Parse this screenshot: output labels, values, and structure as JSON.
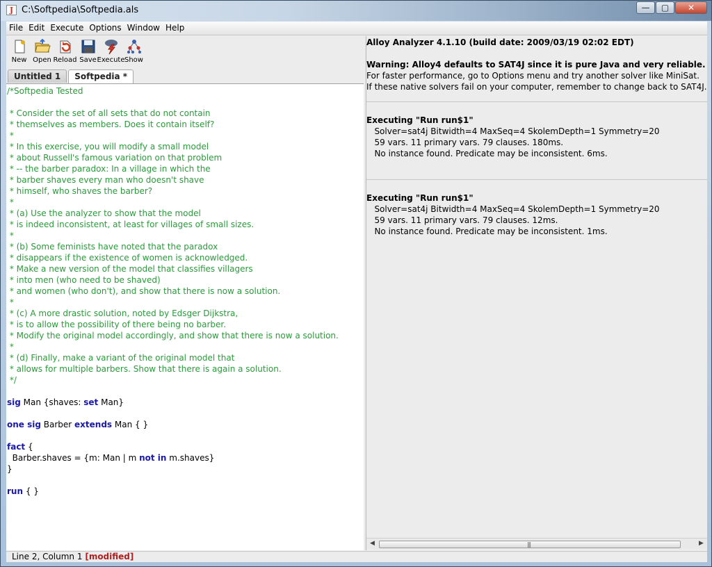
{
  "window": {
    "title": "C:\\Softpedia\\Softpedia.als",
    "minimize": "—",
    "maximize": "▢",
    "close": "✕"
  },
  "menubar": [
    "File",
    "Edit",
    "Execute",
    "Options",
    "Window",
    "Help"
  ],
  "toolbar": [
    {
      "label": "New",
      "icon": "new-icon"
    },
    {
      "label": "Open",
      "icon": "open-icon"
    },
    {
      "label": "Reload",
      "icon": "reload-icon"
    },
    {
      "label": "Save",
      "icon": "save-icon"
    },
    {
      "label": "Execute",
      "icon": "execute-icon"
    },
    {
      "label": "Show",
      "icon": "show-icon"
    }
  ],
  "tabs": [
    {
      "label": "Untitled 1",
      "active": false
    },
    {
      "label": "Softpedia *",
      "active": true
    }
  ],
  "editor": {
    "lines": [
      [
        {
          "t": "/*Softpedia Tested",
          "c": "cmt"
        }
      ],
      [],
      [
        {
          "t": " * Consider the set of all sets that do not contain",
          "c": "cmt"
        }
      ],
      [
        {
          "t": " * themselves as members. Does it contain itself?",
          "c": "cmt"
        }
      ],
      [
        {
          "t": " *",
          "c": "cmt"
        }
      ],
      [
        {
          "t": " * In this exercise, you will modify a small model",
          "c": "cmt"
        }
      ],
      [
        {
          "t": " * about Russell's famous variation on that problem",
          "c": "cmt"
        }
      ],
      [
        {
          "t": " * -- the barber paradox: In a village in which the",
          "c": "cmt"
        }
      ],
      [
        {
          "t": " * barber shaves every man who doesn't shave",
          "c": "cmt"
        }
      ],
      [
        {
          "t": " * himself, who shaves the barber?",
          "c": "cmt"
        }
      ],
      [
        {
          "t": " *",
          "c": "cmt"
        }
      ],
      [
        {
          "t": " * (a) Use the analyzer to show that the model",
          "c": "cmt"
        }
      ],
      [
        {
          "t": " * is indeed inconsistent, at least for villages of small sizes.",
          "c": "cmt"
        }
      ],
      [
        {
          "t": " *",
          "c": "cmt"
        }
      ],
      [
        {
          "t": " * (b) Some feminists have noted that the paradox",
          "c": "cmt"
        }
      ],
      [
        {
          "t": " * disappears if the existence of women is acknowledged.",
          "c": "cmt"
        }
      ],
      [
        {
          "t": " * Make a new version of the model that classifies villagers",
          "c": "cmt"
        }
      ],
      [
        {
          "t": " * into men (who need to be shaved)",
          "c": "cmt"
        }
      ],
      [
        {
          "t": " * and women (who don't), and show that there is now a solution.",
          "c": "cmt"
        }
      ],
      [
        {
          "t": " *",
          "c": "cmt"
        }
      ],
      [
        {
          "t": " * (c) A more drastic solution, noted by Edsger Dijkstra,",
          "c": "cmt"
        }
      ],
      [
        {
          "t": " * is to allow the possibility of there being no barber.",
          "c": "cmt"
        }
      ],
      [
        {
          "t": " * Modify the original model accordingly, and show that there is now a solution.",
          "c": "cmt"
        }
      ],
      [
        {
          "t": " *",
          "c": "cmt"
        }
      ],
      [
        {
          "t": " * (d) Finally, make a variant of the original model that",
          "c": "cmt"
        }
      ],
      [
        {
          "t": " * allows for multiple barbers. Show that there is again a solution.",
          "c": "cmt"
        }
      ],
      [
        {
          "t": " */",
          "c": "cmt"
        }
      ],
      [],
      [
        {
          "t": "sig",
          "c": "kw"
        },
        {
          "t": " Man {shaves: ",
          "c": "plain"
        },
        {
          "t": "set",
          "c": "kw"
        },
        {
          "t": " Man}",
          "c": "plain"
        }
      ],
      [],
      [
        {
          "t": "one sig",
          "c": "kw"
        },
        {
          "t": " Barber ",
          "c": "plain"
        },
        {
          "t": "extends",
          "c": "kw"
        },
        {
          "t": " Man { }",
          "c": "plain"
        }
      ],
      [],
      [
        {
          "t": "fact",
          "c": "kw"
        },
        {
          "t": " {",
          "c": "plain"
        }
      ],
      [
        {
          "t": "  Barber.shaves = {m: Man | m ",
          "c": "plain"
        },
        {
          "t": "not in",
          "c": "kw"
        },
        {
          "t": " m.shaves}",
          "c": "plain"
        }
      ],
      [
        {
          "t": "}",
          "c": "plain"
        }
      ],
      [],
      [
        {
          "t": "run",
          "c": "kw"
        },
        {
          "t": " { }",
          "c": "plain"
        }
      ]
    ]
  },
  "output": {
    "header": "Alloy Analyzer 4.1.10 (build date: 2009/03/19 02:02 EDT)",
    "warning": "Warning: Alloy4 defaults to SAT4J since it is pure Java and very reliable.",
    "info1": "For faster performance, go to Options menu and try another solver like MiniSat.",
    "info2": "If these native solvers fail on your computer, remember to change back to SAT4J.",
    "runs": [
      {
        "title": "Executing \"Run run$1\"",
        "solver": "   Solver=sat4j Bitwidth=4 MaxSeq=4 SkolemDepth=1 Symmetry=20",
        "stats": "   59 vars. 11 primary vars. 79 clauses. 180ms.",
        "result": "   No instance found. Predicate may be inconsistent. 6ms."
      },
      {
        "title": "Executing \"Run run$1\"",
        "solver": "   Solver=sat4j Bitwidth=4 MaxSeq=4 SkolemDepth=1 Symmetry=20",
        "stats": "   59 vars. 11 primary vars. 79 clauses. 12ms.",
        "result": "   No instance found. Predicate may be inconsistent. 1ms."
      }
    ]
  },
  "status": {
    "position": "Line 2, Column 1",
    "modified": "[modified]"
  }
}
